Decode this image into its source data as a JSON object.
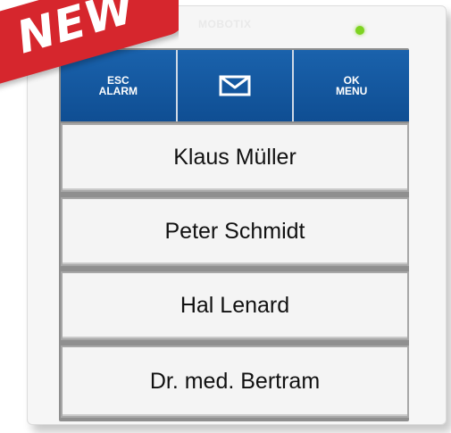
{
  "badge": {
    "text": "NEW",
    "color": "#d6262d"
  },
  "device": {
    "brand": "MOBOTIX",
    "led_color": "#7ed321",
    "keypad_color": "#1a62ac"
  },
  "keys": {
    "esc_line1": "ESC",
    "esc_line2": "ALARM",
    "mail_icon": "envelope-icon",
    "ok_line1": "OK",
    "ok_line2": "MENU"
  },
  "names": [
    "Klaus Müller",
    "Peter Schmidt",
    "Hal Lenard",
    "Dr. med. Bertram"
  ]
}
